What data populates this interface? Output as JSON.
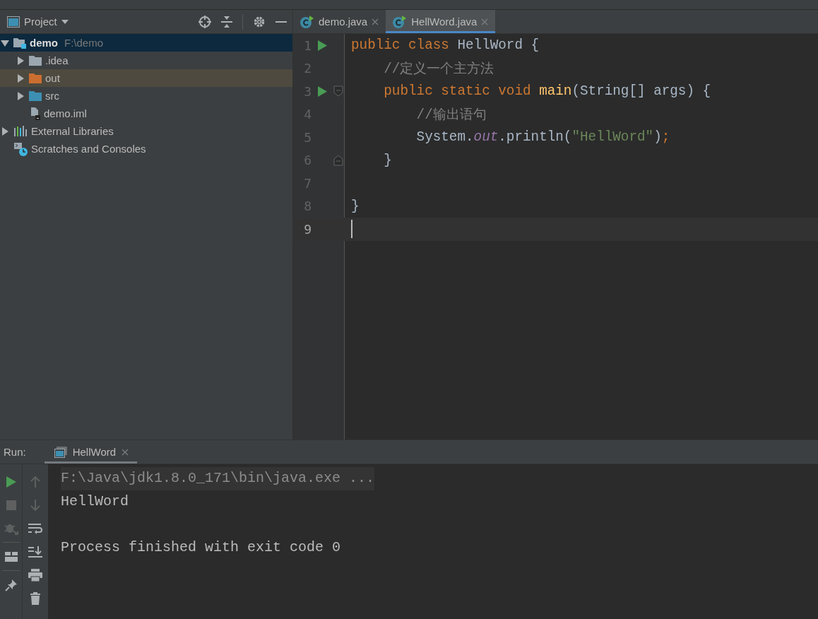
{
  "project_panel": {
    "title": "Project",
    "tree": [
      {
        "label": "demo",
        "path": "F:\\demo",
        "kind": "module",
        "expanded": true,
        "selected": true,
        "highlighted": false,
        "children": [
          {
            "label": ".idea",
            "kind": "folder",
            "expanded": false,
            "selected": false,
            "highlighted": false
          },
          {
            "label": "out",
            "kind": "excluded-folder",
            "expanded": false,
            "selected": false,
            "highlighted": true
          },
          {
            "label": "src",
            "kind": "source-folder",
            "expanded": false,
            "selected": false,
            "highlighted": false
          },
          {
            "label": "demo.iml",
            "kind": "file",
            "selected": false,
            "highlighted": false
          }
        ]
      },
      {
        "label": "External Libraries",
        "kind": "libraries",
        "expanded": false,
        "selected": false,
        "highlighted": false
      },
      {
        "label": "Scratches and Consoles",
        "kind": "scratches",
        "selected": false,
        "highlighted": false
      }
    ]
  },
  "editor": {
    "tabs": [
      {
        "label": "demo.java",
        "selected": false
      },
      {
        "label": "HellWord.java",
        "selected": true
      }
    ],
    "lines": [
      {
        "number": "1",
        "run": true,
        "kind": "code",
        "current": false,
        "tokens": [
          {
            "kind": "keyword",
            "text": "public class "
          },
          {
            "kind": "plain",
            "text": "HellWord {"
          }
        ]
      },
      {
        "number": "2",
        "run": false,
        "kind": "code",
        "current": false,
        "tokens": [
          {
            "kind": "comment",
            "text": "    //定义一个主方法"
          }
        ]
      },
      {
        "number": "3",
        "run": true,
        "kind": "fold-start",
        "current": false,
        "tokens": [
          {
            "kind": "keyword",
            "text": "    public static void "
          },
          {
            "kind": "method",
            "text": "main"
          },
          {
            "kind": "plain",
            "text": "(String[] args) {"
          }
        ]
      },
      {
        "number": "4",
        "run": false,
        "kind": "code",
        "current": false,
        "tokens": [
          {
            "kind": "comment",
            "text": "        //输出语句"
          }
        ]
      },
      {
        "number": "5",
        "run": false,
        "kind": "code",
        "current": false,
        "tokens": [
          {
            "kind": "plain",
            "text": "        System."
          },
          {
            "kind": "static",
            "text": "out"
          },
          {
            "kind": "plain",
            "text": ".println("
          },
          {
            "kind": "string",
            "text": "\"HellWord\""
          },
          {
            "kind": "plain",
            "text": ")"
          },
          {
            "kind": "keyword",
            "text": ";"
          }
        ]
      },
      {
        "number": "6",
        "run": false,
        "kind": "fold-end",
        "current": false,
        "tokens": [
          {
            "kind": "plain",
            "text": "    }"
          }
        ]
      },
      {
        "number": "7",
        "run": false,
        "kind": "code",
        "current": false
      },
      {
        "number": "8",
        "run": false,
        "kind": "code",
        "current": false,
        "tokens": [
          {
            "kind": "plain",
            "text": "}"
          }
        ]
      },
      {
        "number": "9",
        "run": false,
        "kind": "code",
        "current": true
      }
    ]
  },
  "run_panel": {
    "label": "Run:",
    "tabs": [
      {
        "label": "HellWord",
        "selected": true
      }
    ],
    "console": [
      {
        "kind": "command",
        "text": "F:\\Java\\jdk1.8.0_171\\bin\\java.exe ..."
      },
      {
        "kind": "output",
        "text": "HellWord"
      },
      {
        "kind": "status",
        "text": "Process finished with exit code 0"
      }
    ]
  }
}
